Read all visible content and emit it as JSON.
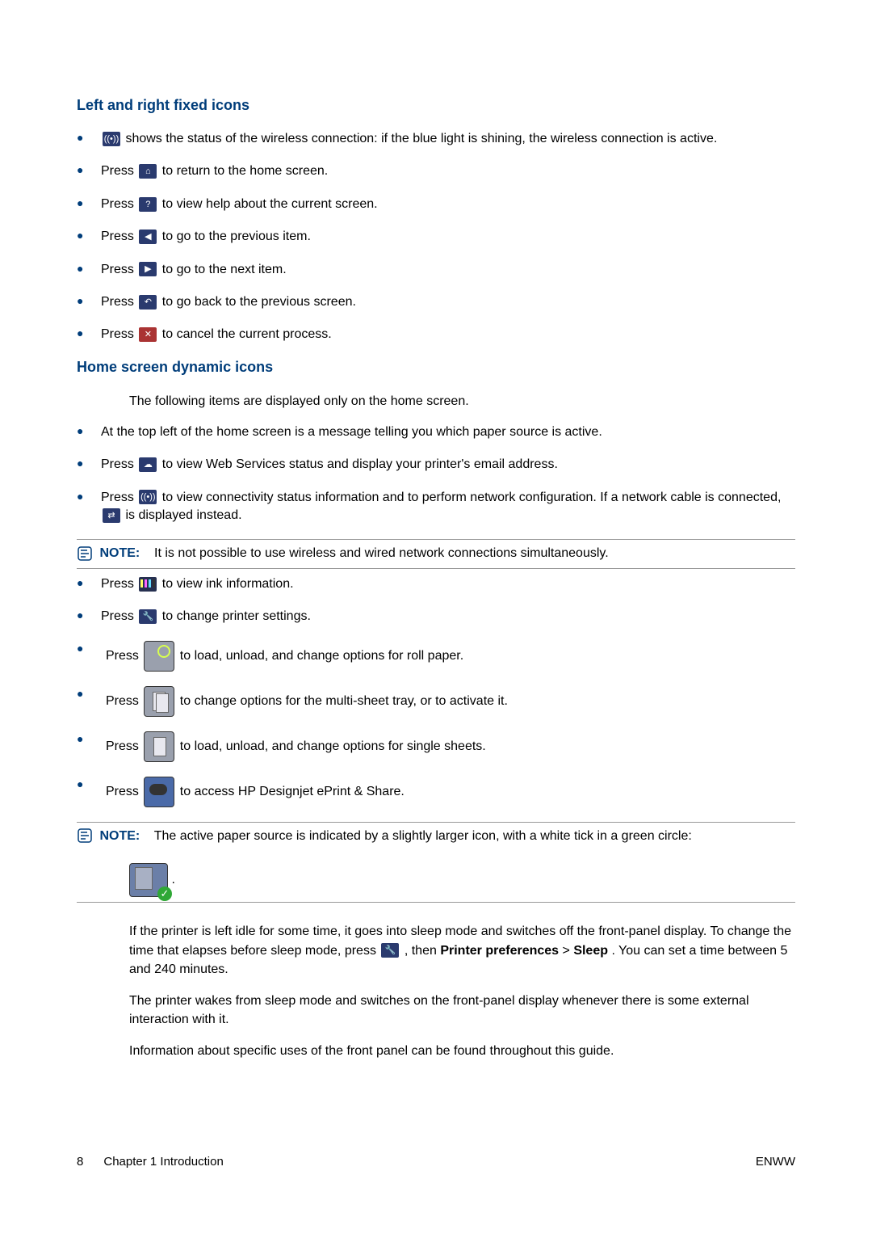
{
  "sections": {
    "left_right": {
      "heading": "Left and right fixed icons",
      "items": [
        {
          "text_a": "",
          "text_b": " shows the status of the wireless connection: if the blue light is shining, the wireless connection is active."
        },
        {
          "text_a": "Press ",
          "text_b": " to return to the home screen."
        },
        {
          "text_a": "Press ",
          "text_b": " to view help about the current screen."
        },
        {
          "text_a": "Press ",
          "text_b": " to go to the previous item."
        },
        {
          "text_a": "Press ",
          "text_b": " to go to the next item."
        },
        {
          "text_a": "Press ",
          "text_b": " to go back to the previous screen."
        },
        {
          "text_a": "Press ",
          "text_b": " to cancel the current process."
        }
      ]
    },
    "home_dynamic": {
      "heading": "Home screen dynamic icons",
      "intro": "The following items are displayed only on the home screen.",
      "items1": [
        "At the top left of the home screen is a message telling you which paper source is active.",
        {
          "text_a": "Press ",
          "text_b": " to view Web Services status and display your printer's email address."
        },
        {
          "text_a": "Press ",
          "text_b": " to view connectivity status information and to perform network configuration. If a network cable is connected, ",
          "text_c": " is displayed instead."
        }
      ],
      "note1_label": "NOTE:",
      "note1_text": "It is not possible to use wireless and wired network connections simultaneously.",
      "items2": [
        {
          "text_a": "Press ",
          "text_b": " to view ink information."
        },
        {
          "text_a": "Press ",
          "text_b": " to change printer settings."
        }
      ],
      "items3": [
        {
          "text_a": "Press ",
          "text_b": " to load, unload, and change options for roll paper."
        },
        {
          "text_a": "Press ",
          "text_b": " to change options for the multi-sheet tray, or to activate it."
        },
        {
          "text_a": "Press ",
          "text_b": " to load, unload, and change options for single sheets."
        },
        {
          "text_a": "Press ",
          "text_b": " to access HP Designjet ePrint & Share."
        }
      ],
      "note2_label": "NOTE:",
      "note2_text_a": "The active paper source is indicated by a slightly larger icon, with a white tick in a green circle: ",
      "note2_text_b": "."
    },
    "tail": {
      "p1_a": "If the printer is left idle for some time, it goes into sleep mode and switches off the front-panel display. To change the time that elapses before sleep mode, press ",
      "p1_b": ", then ",
      "p1_bold1": "Printer preferences",
      "p1_gt": " > ",
      "p1_bold2": "Sleep",
      "p1_c": ". You can set a time between 5 and 240 minutes.",
      "p2": "The printer wakes from sleep mode and switches on the front-panel display whenever there is some external interaction with it.",
      "p3": "Information about specific uses of the front panel can be found throughout this guide."
    }
  },
  "footer": {
    "page": "8",
    "chapter": "Chapter 1   Introduction",
    "right": "ENWW"
  }
}
